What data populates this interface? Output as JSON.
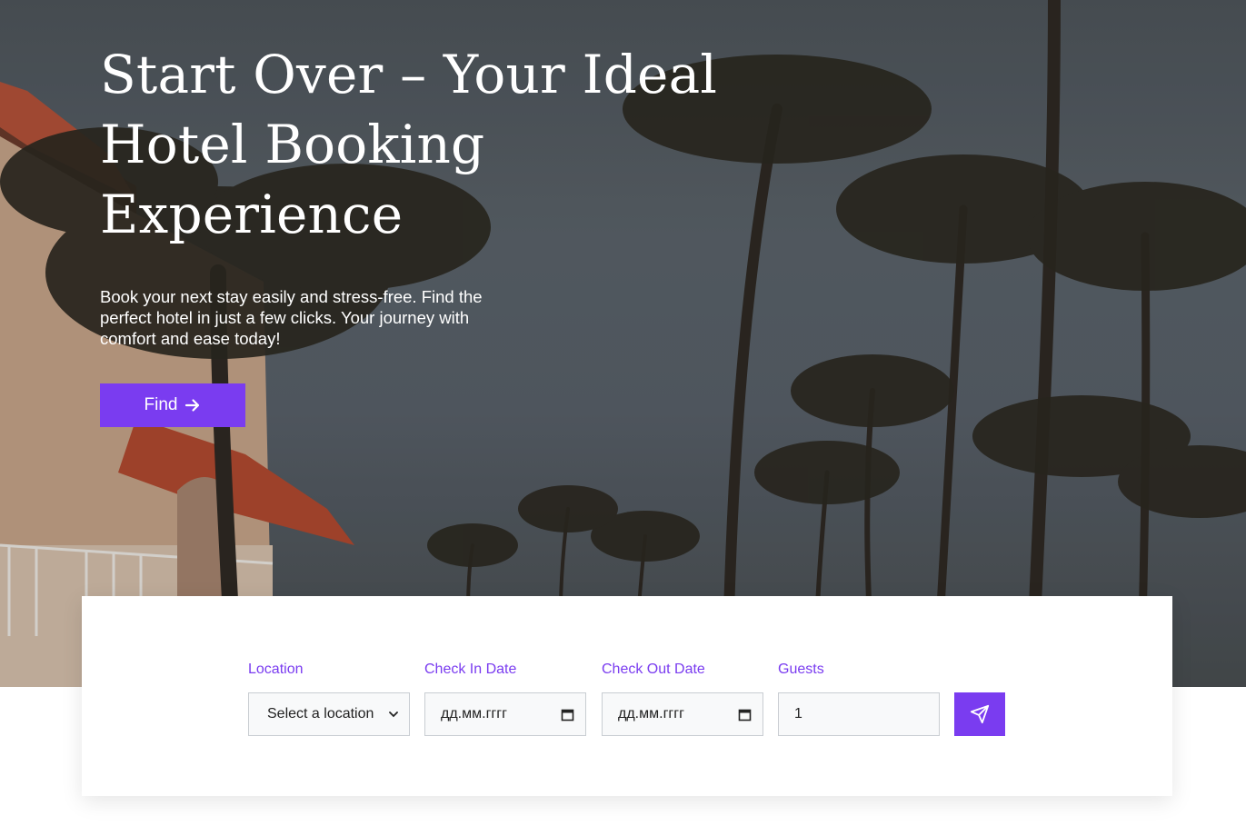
{
  "hero": {
    "title": "Start Over – Your Ideal Hotel Booking Experience",
    "subtitle": "Book your next stay easily and stress-free. Find the perfect hotel in just a few clicks. Your journey with comfort and ease today!",
    "find_button_label": "Find",
    "find_button_icon": "arrow-right-icon",
    "background_image": "palm-trees-hotel-photo"
  },
  "search": {
    "location": {
      "label": "Location",
      "selected": "Select a location",
      "icon": "chevron-down-icon"
    },
    "check_in": {
      "label": "Check In Date",
      "value": "дд.мм.гггг",
      "icon": "calendar-icon"
    },
    "check_out": {
      "label": "Check Out Date",
      "value": "дд.мм.гггг",
      "icon": "calendar-icon"
    },
    "guests": {
      "label": "Guests",
      "value": "1"
    },
    "submit_icon": "send-icon"
  },
  "colors": {
    "accent": "#7a3cf0",
    "field_background": "#f8f9fa",
    "field_border": "#c9cdd2"
  }
}
